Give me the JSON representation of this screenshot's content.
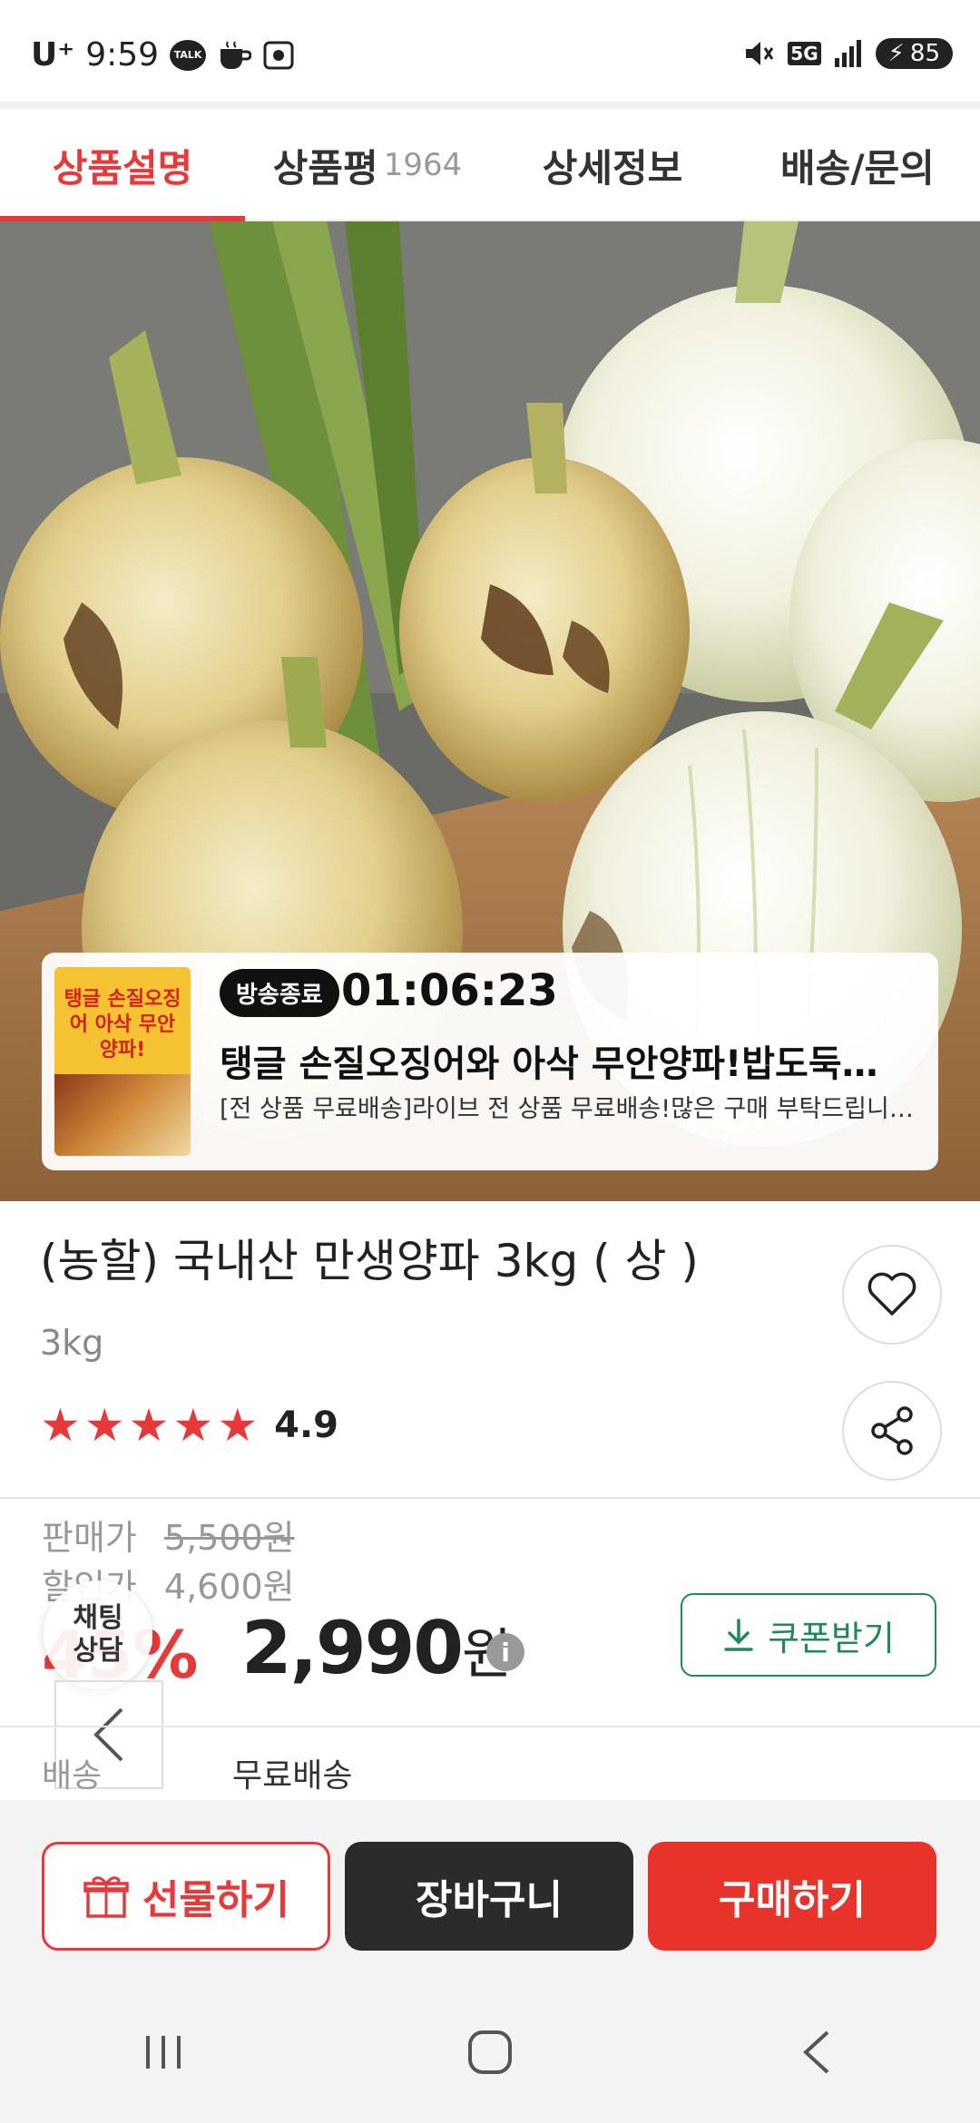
{
  "status_bar": {
    "carrier": "U⁺",
    "time": "9:59",
    "talk_label": "TALK",
    "network": "5G",
    "battery": "85"
  },
  "tabs": [
    {
      "label": "상품설명",
      "count": ""
    },
    {
      "label": "상품평",
      "count": "1964"
    },
    {
      "label": "상세정보",
      "count": ""
    },
    {
      "label": "배송/문의",
      "count": ""
    }
  ],
  "live": {
    "thumb_title": "탱글 손질오징어 아삭 무안양파!",
    "badge": "방송종료",
    "timer": "01:06:23",
    "title": "탱글 손질오징어와 아삭 무안양파!밥도둑…",
    "subtitle": "[전 상품 무료배송]라이브 전 상품 무료배송!많은 구매 부탁드립니다😊[…"
  },
  "product": {
    "title": "(농할) 국내산 만생양파 3kg ( 상 )",
    "option": "3kg",
    "rating": "4.9",
    "stars": 5
  },
  "price": {
    "sale_label": "판매가",
    "sale_value": "5,500원",
    "discount_label": "할인가",
    "discount_value": "4,600원",
    "percent": "45%",
    "final_number": "2,990",
    "final_unit": "원",
    "info_glyph": "i"
  },
  "coupon_label": "쿠폰받기",
  "chat_label_1": "채팅",
  "chat_label_2": "상담",
  "shipping": {
    "label": "배송",
    "value": "무료배송"
  },
  "actions": {
    "gift": "선물하기",
    "cart": "장바구니",
    "buy": "구매하기"
  },
  "colors": {
    "accent": "#e8393a",
    "coupon": "#1e8a5a",
    "cart": "#2b2b2b",
    "buy": "#e8332a"
  },
  "icons": {
    "wish": "heart-icon",
    "share": "share-icon",
    "coupon": "download-icon",
    "gift": "gift-icon",
    "nav_recent": "recent-apps-icon",
    "nav_home": "home-icon",
    "nav_back": "back-icon"
  }
}
